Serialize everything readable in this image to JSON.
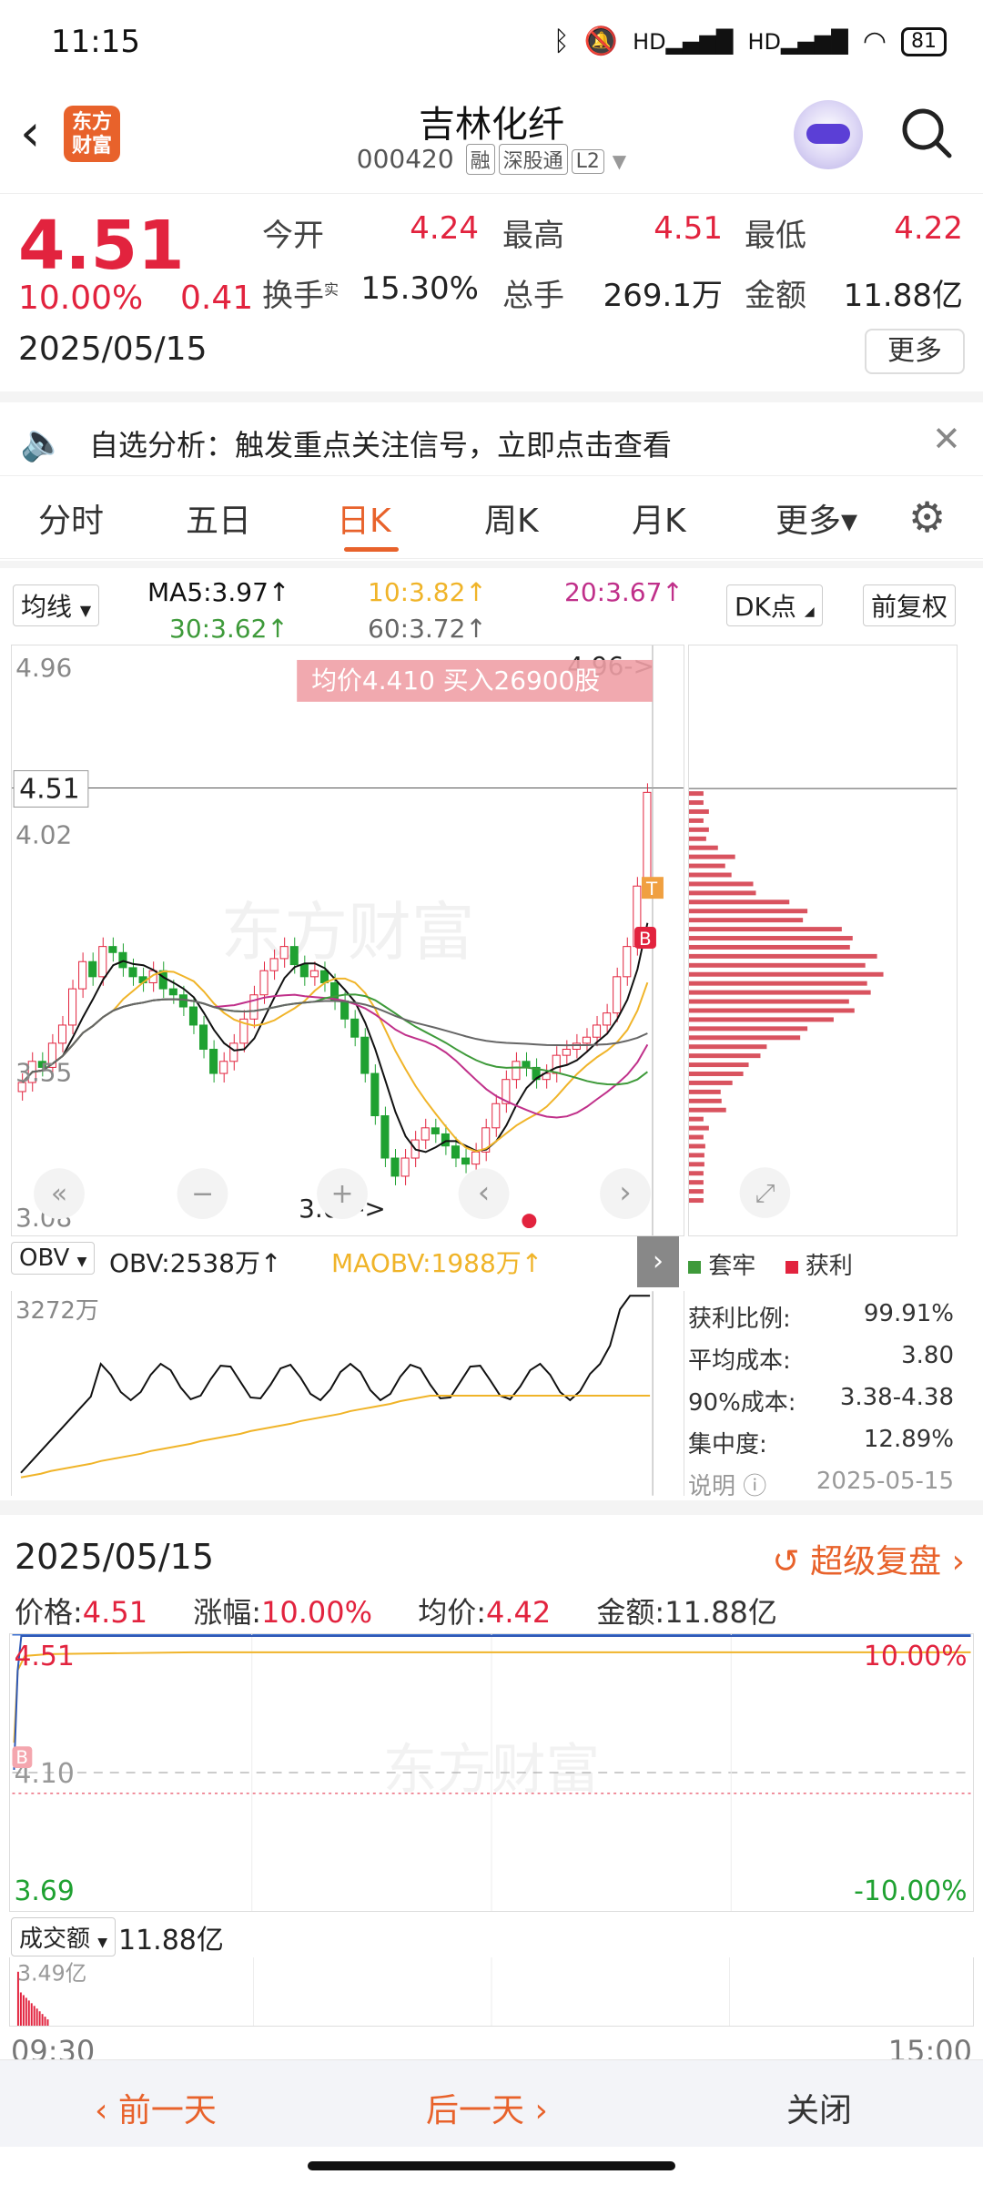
{
  "status": {
    "time": "11:15",
    "battery": "81",
    "icons": [
      "bluetooth-icon",
      "mute-icon",
      "hd-signal-icon",
      "hd-signal-icon",
      "wifi-icon"
    ]
  },
  "header": {
    "title": "吉林化纤",
    "code": "000420",
    "tags": [
      "融",
      "深股通",
      "L2"
    ],
    "logo": "东方财富"
  },
  "quote": {
    "price": "4.51",
    "change_pct": "10.00%",
    "change": "0.41",
    "date": "2025/05/15",
    "open_label": "今开",
    "open": "4.24",
    "high_label": "最高",
    "high": "4.51",
    "low_label": "最低",
    "low": "4.22",
    "turnover_label": "换手",
    "turnover_sup": "实",
    "turnover": "15.30%",
    "volume_label": "总手",
    "volume": "269.1万",
    "amount_label": "金额",
    "amount": "11.88亿",
    "more": "更多"
  },
  "banner": {
    "text": "自选分析：触发重点关注信号，立即点击查看"
  },
  "tabs": [
    "分时",
    "五日",
    "日K",
    "周K",
    "月K",
    "更多▾"
  ],
  "active_tab": "日K",
  "indicators": {
    "selector": "均线",
    "ma5": "MA5:3.97↑",
    "ma10": "10:3.82↑",
    "ma20": "20:3.67↑",
    "ma30": "30:3.62↑",
    "ma60": "60:3.72↑",
    "dk": "DK点",
    "adjust": "前复权"
  },
  "kchart": {
    "y_top": "4.96",
    "y_price": "4.51",
    "y_mid": "4.02",
    "y_low2": "3.55",
    "y_bottom": "3.08",
    "low_marker": "3.08->",
    "high_marker": "4.96->",
    "tooltip": "均价4.410  买入26900股",
    "watermark": "东方财富",
    "t_marker": "T",
    "b_marker": "B",
    "controls": [
      "«",
      "−",
      "+",
      "‹",
      "›"
    ]
  },
  "colors": {
    "red": "#e2233e",
    "green": "#1fa131",
    "orange": "#e8622b",
    "ma5": "#111111",
    "ma10": "#f0b429",
    "ma20": "#c0308a",
    "ma30": "#3e9a3a",
    "ma60": "#666666"
  },
  "obv": {
    "selector": "OBV",
    "obv": "OBV:2538万↑",
    "maobv": "MAOBV:1988万↑",
    "y_top": "3272万"
  },
  "profit": {
    "legend_trap": "套牢",
    "legend_profit": "获利",
    "rows": [
      {
        "label": "获利比例:",
        "value": "99.91%"
      },
      {
        "label": "平均成本:",
        "value": "3.80"
      },
      {
        "label": "90%成本:",
        "value": "3.38-4.38"
      },
      {
        "label": "集中度:",
        "value": "12.89%"
      },
      {
        "label": "说明",
        "value": "2025-05-15"
      }
    ]
  },
  "replay": {
    "date": "2025/05/15",
    "link": "超级复盘",
    "price_label": "价格:",
    "price": "4.51",
    "pct_label": "涨幅:",
    "pct": "10.00%",
    "avg_label": "均价:",
    "avg": "4.42",
    "amount_label": "金额:",
    "amount": "11.88亿",
    "y_top": "4.51",
    "y_mid": "4.10",
    "y_bottom": "3.69",
    "pct_top": "10.00%",
    "pct_bottom": "-10.00%",
    "b_marker": "B",
    "vol_selector": "成交额",
    "vol_value": "11.88亿",
    "vol_max": "3.49亿",
    "t_start": "09:30",
    "t_end": "15:00",
    "watermark": "东方财富"
  },
  "footer": {
    "prev": "‹ 前一天",
    "next": "后一天 ›",
    "close": "关闭"
  }
}
